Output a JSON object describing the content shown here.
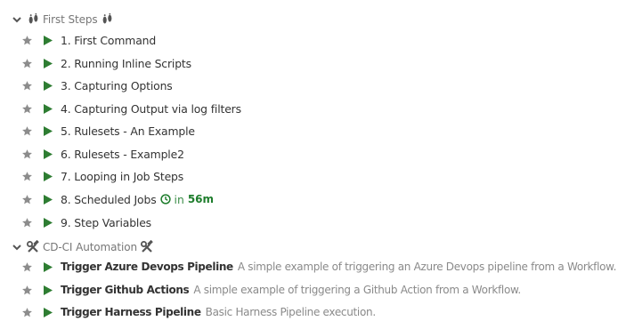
{
  "colors": {
    "star": "#8c8c8c",
    "play": "#2e7d32",
    "schedule": "#1e7d2c",
    "group_title": "#777777",
    "job_name": "#333333",
    "description": "#8a8a8a"
  },
  "groups": [
    {
      "title": "First Steps",
      "icon": "footprints-icon",
      "expanded": true,
      "jobs": [
        {
          "name": "1. First Command"
        },
        {
          "name": "2. Running Inline Scripts"
        },
        {
          "name": "3. Capturing Options"
        },
        {
          "name": "4. Capturing Output via log filters"
        },
        {
          "name": "5. Rulesets - An Example"
        },
        {
          "name": "6. Rulesets - Example2"
        },
        {
          "name": "7. Looping in Job Steps"
        },
        {
          "name": "8. Scheduled Jobs",
          "schedule_prefix": "in",
          "schedule_time": "56m"
        },
        {
          "name": "9. Step Variables"
        }
      ]
    },
    {
      "title": "CD-CI Automation",
      "icon": "hammer-wrench-icon",
      "expanded": true,
      "jobs": [
        {
          "name": "Trigger Azure Devops Pipeline",
          "description": "A simple example of triggering an Azure Devops pipeline from a Workflow."
        },
        {
          "name": "Trigger Github Actions",
          "description": "A simple example of triggering a Github Action from a Workflow."
        },
        {
          "name": "Trigger Harness Pipeline",
          "description": "Basic Harness Pipeline execution."
        }
      ]
    }
  ]
}
